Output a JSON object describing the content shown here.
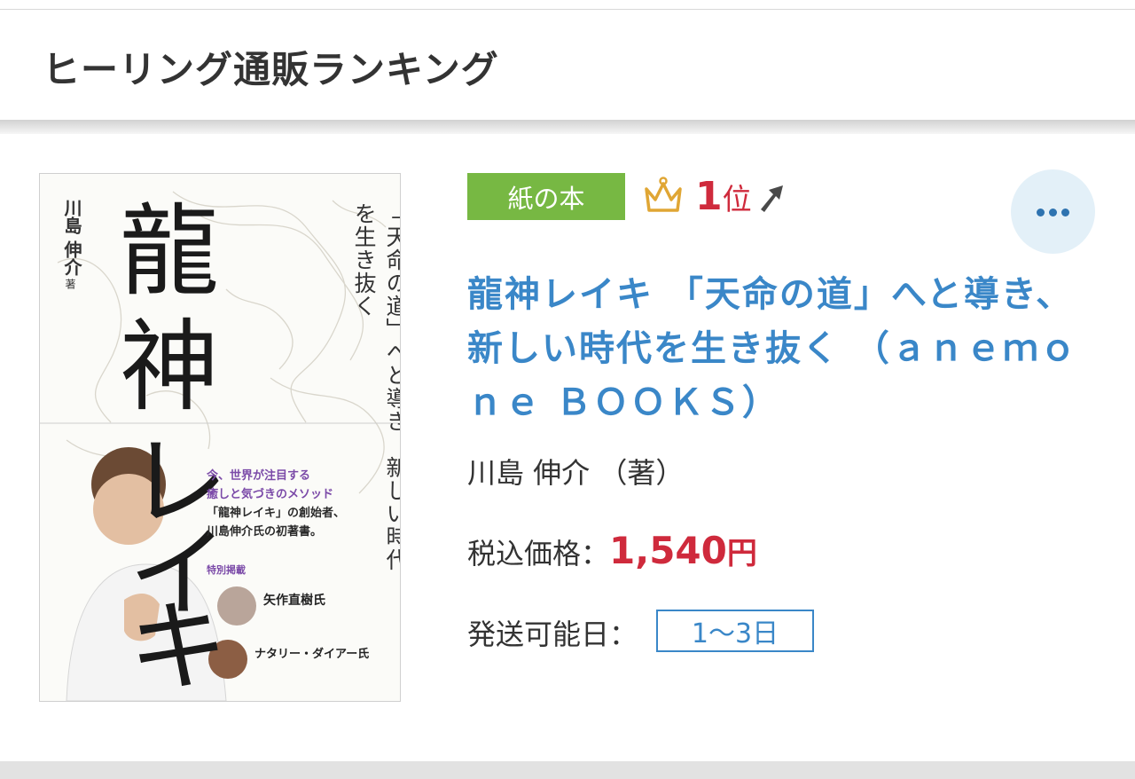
{
  "header": {
    "title": "ヒーリング通販ランキング"
  },
  "product": {
    "format_badge": "紙の本",
    "rank_number": "1",
    "rank_unit": "位",
    "title": "龍神レイキ 「天命の道」へと導き、新しい時代を生き抜く （ａｎｅｍｏｎｅ ＢＯＯＫＳ）",
    "author": "川島 伸介 （著）",
    "price_label": "税込価格：",
    "price_value": "1,540",
    "price_unit": "円",
    "ship_label": "発送可能日：",
    "ship_value": "1〜3日"
  },
  "cover": {
    "main_title_1": "龍",
    "main_title_2": "神",
    "main_title_3": "レ",
    "main_title_4": "イ",
    "main_title_5": "キ",
    "subtitle": "「天命の道」へと導き、新しい時代を生き抜く",
    "author": "川島 伸介",
    "author_suffix": "著",
    "blurb_1": "今、世界が注目する",
    "blurb_2": "癒しと気づきのメソッド",
    "blurb_3": "「龍神レイキ」の創始者、",
    "blurb_4": "川島伸介氏の初著書。",
    "special": "特別掲載",
    "guest1_name": "矢作直樹氏",
    "guest2_name": "ナタリー・ダイアー氏"
  },
  "colors": {
    "accent_blue": "#3a87c8",
    "price_red": "#cf2a3c",
    "badge_green": "#77b843"
  },
  "icons": {
    "crown": "crown-icon",
    "rank_up": "arrow-up-icon",
    "more": "more-icon"
  }
}
